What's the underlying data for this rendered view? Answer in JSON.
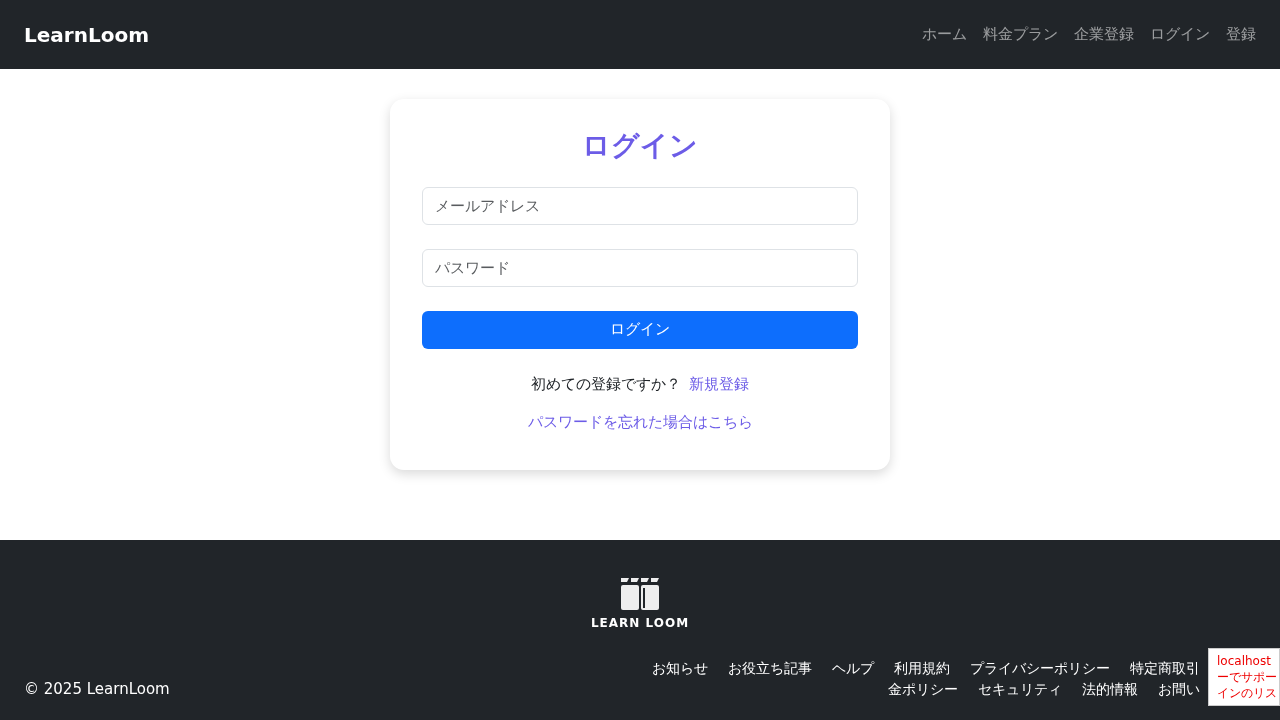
{
  "navbar": {
    "brand": "LearnLoom",
    "links": [
      {
        "label": "ホーム"
      },
      {
        "label": "料金プラン"
      },
      {
        "label": "企業登録"
      },
      {
        "label": "ログイン"
      },
      {
        "label": "登録"
      }
    ]
  },
  "login": {
    "title": "ログイン",
    "email": {
      "placeholder": "メールアドレス"
    },
    "password": {
      "placeholder": "パスワード"
    },
    "submit": "ログイン",
    "signup_prompt": "初めての登録ですか？",
    "signup_link": "新規登録",
    "forgot_link": "パスワードを忘れた場合はこちら"
  },
  "footer": {
    "logo_text": "LEARN LOOM",
    "copyright": "© 2025 LearnLoom",
    "links": [
      {
        "label": "お知らせ"
      },
      {
        "label": "お役立ち記事"
      },
      {
        "label": "ヘルプ"
      },
      {
        "label": "利用規約"
      },
      {
        "label": "プライバシーポリシー"
      },
      {
        "label": "特定商取引"
      },
      {
        "label": "金ポリシー"
      },
      {
        "label": "セキュリティ"
      },
      {
        "label": "法的情報"
      },
      {
        "label": "お問い"
      }
    ]
  },
  "popup": {
    "lines": [
      "localhost",
      "ーでサポー",
      "インのリス"
    ]
  }
}
